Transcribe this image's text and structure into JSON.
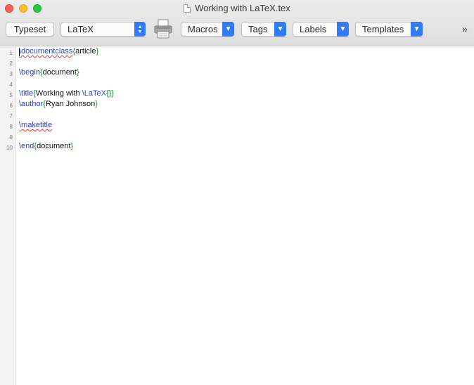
{
  "window": {
    "title": "Working with LaTeX.tex"
  },
  "toolbar": {
    "typeset_label": "Typeset",
    "engine_value": "LaTeX",
    "macros_label": "Macros",
    "tags_label": "Tags",
    "labels_label": "Labels",
    "templates_label": "Templates",
    "overflow_label": "»"
  },
  "editor": {
    "lines": [
      {
        "n": "1",
        "cmd": "\\documentclass",
        "open": "{",
        "arg": "article",
        "close": "}"
      },
      {
        "n": "2"
      },
      {
        "n": "3",
        "cmd": "\\begin",
        "open": "{",
        "arg": "document",
        "close": "}"
      },
      {
        "n": "4"
      },
      {
        "n": "5",
        "cmd": "\\title",
        "open": "{",
        "arg": "Working with ",
        "cmd2": "\\LaTeX",
        "inner": "{}",
        "close": "}"
      },
      {
        "n": "6",
        "cmd": "\\author",
        "open": "{",
        "arg": "Ryan Johnson",
        "close": "}"
      },
      {
        "n": "7"
      },
      {
        "n": "8",
        "cmd": "\\maketitle"
      },
      {
        "n": "9"
      },
      {
        "n": "10",
        "cmd": "\\end",
        "open": "{",
        "arg": "document",
        "close": "}"
      }
    ]
  }
}
